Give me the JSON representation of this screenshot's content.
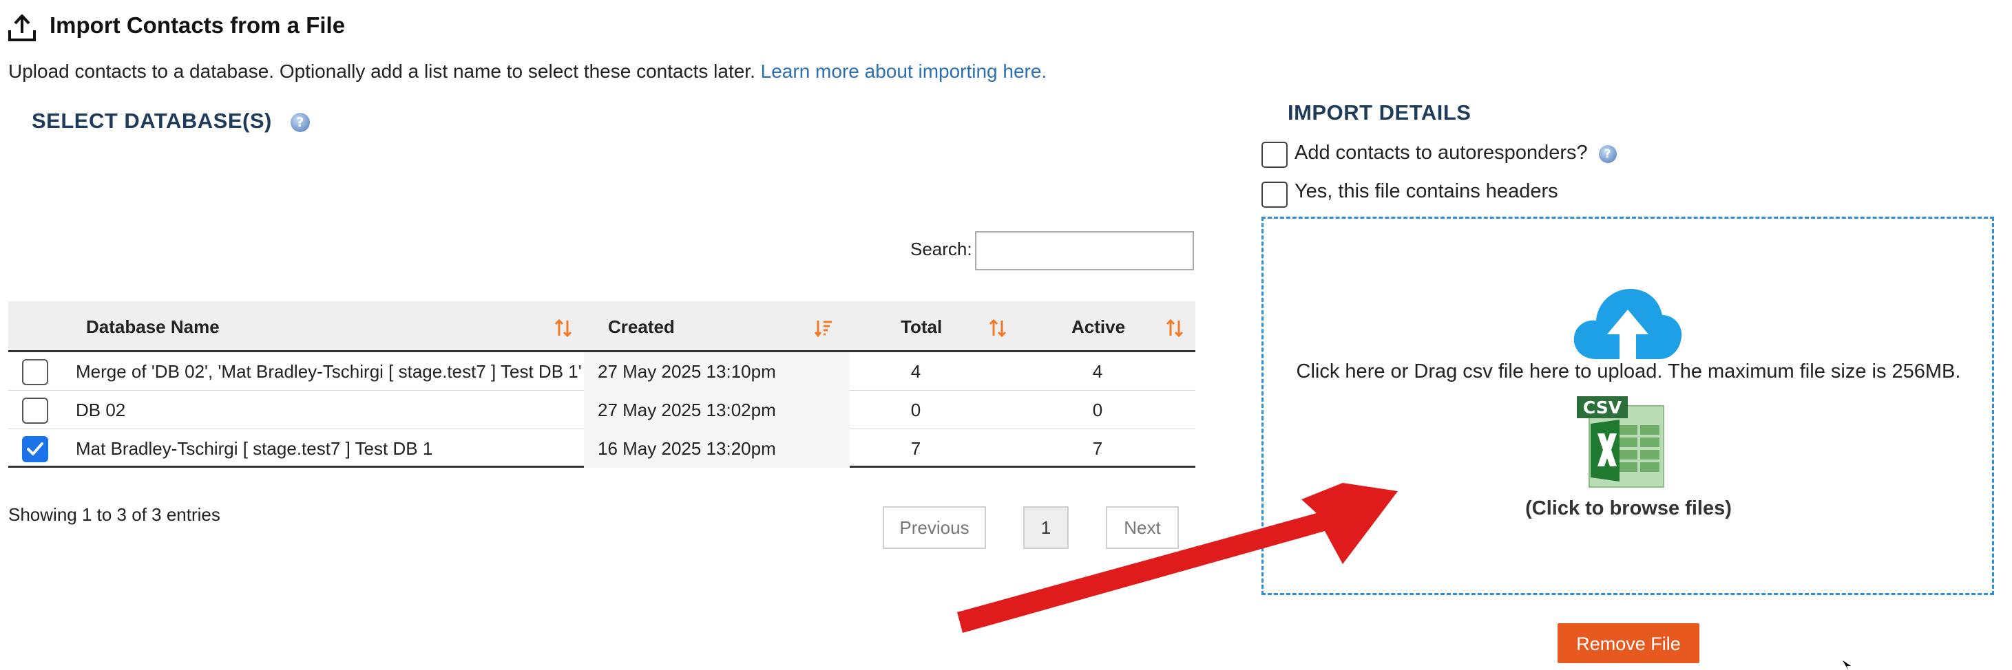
{
  "header": {
    "title": "Import Contacts from a File",
    "icon": "upload-tray-icon"
  },
  "intro": {
    "text": "Upload contacts to a database. Optionally add a list name to select these contacts later.",
    "link_text": "Learn more about importing here."
  },
  "select_section": {
    "title": "SELECT DATABASE(S)",
    "help_icon": "?"
  },
  "search": {
    "label": "Search:",
    "value": "",
    "placeholder": ""
  },
  "table": {
    "columns": [
      "Database Name",
      "Created",
      "Total",
      "Active"
    ],
    "rows": [
      {
        "checked": false,
        "name": "Merge of 'DB 02', 'Mat Bradley-Tschirgi [ stage.test7 ] Test DB 1'",
        "created": "27 May 2025 13:10pm",
        "total": "4",
        "active": "4"
      },
      {
        "checked": false,
        "name": "DB 02",
        "created": "27 May 2025 13:02pm",
        "total": "0",
        "active": "0"
      },
      {
        "checked": true,
        "name": "Mat Bradley-Tschirgi [ stage.test7 ] Test DB 1",
        "created": "16 May 2025 13:20pm",
        "total": "7",
        "active": "7"
      }
    ],
    "info": "Showing 1 to 3 of 3 entries"
  },
  "pagination": {
    "previous": "Previous",
    "current_page": "1",
    "next": "Next"
  },
  "import_details": {
    "title": "IMPORT DETAILS",
    "autoresponders_label": "Add contacts to autoresponders?",
    "autoresponders_checked": false,
    "headers_label": "Yes, this file contains headers",
    "headers_checked": false,
    "dropzone_text": "Click here or Drag csv file here to upload. The maximum file size is 256MB.",
    "csv_badge": "CSV",
    "browse_text": "(Click to browse files)",
    "remove_button": "Remove File"
  },
  "colors": {
    "accent_blue": "#2a6fb3",
    "section_title": "#1f3b5c",
    "sort_arrows": "#f07a2a",
    "checkbox_checked": "#1a73e8",
    "dropzone_border": "#2d8ed8",
    "remove_button": "#e8591f",
    "annotation_arrow": "#e01b1b"
  }
}
